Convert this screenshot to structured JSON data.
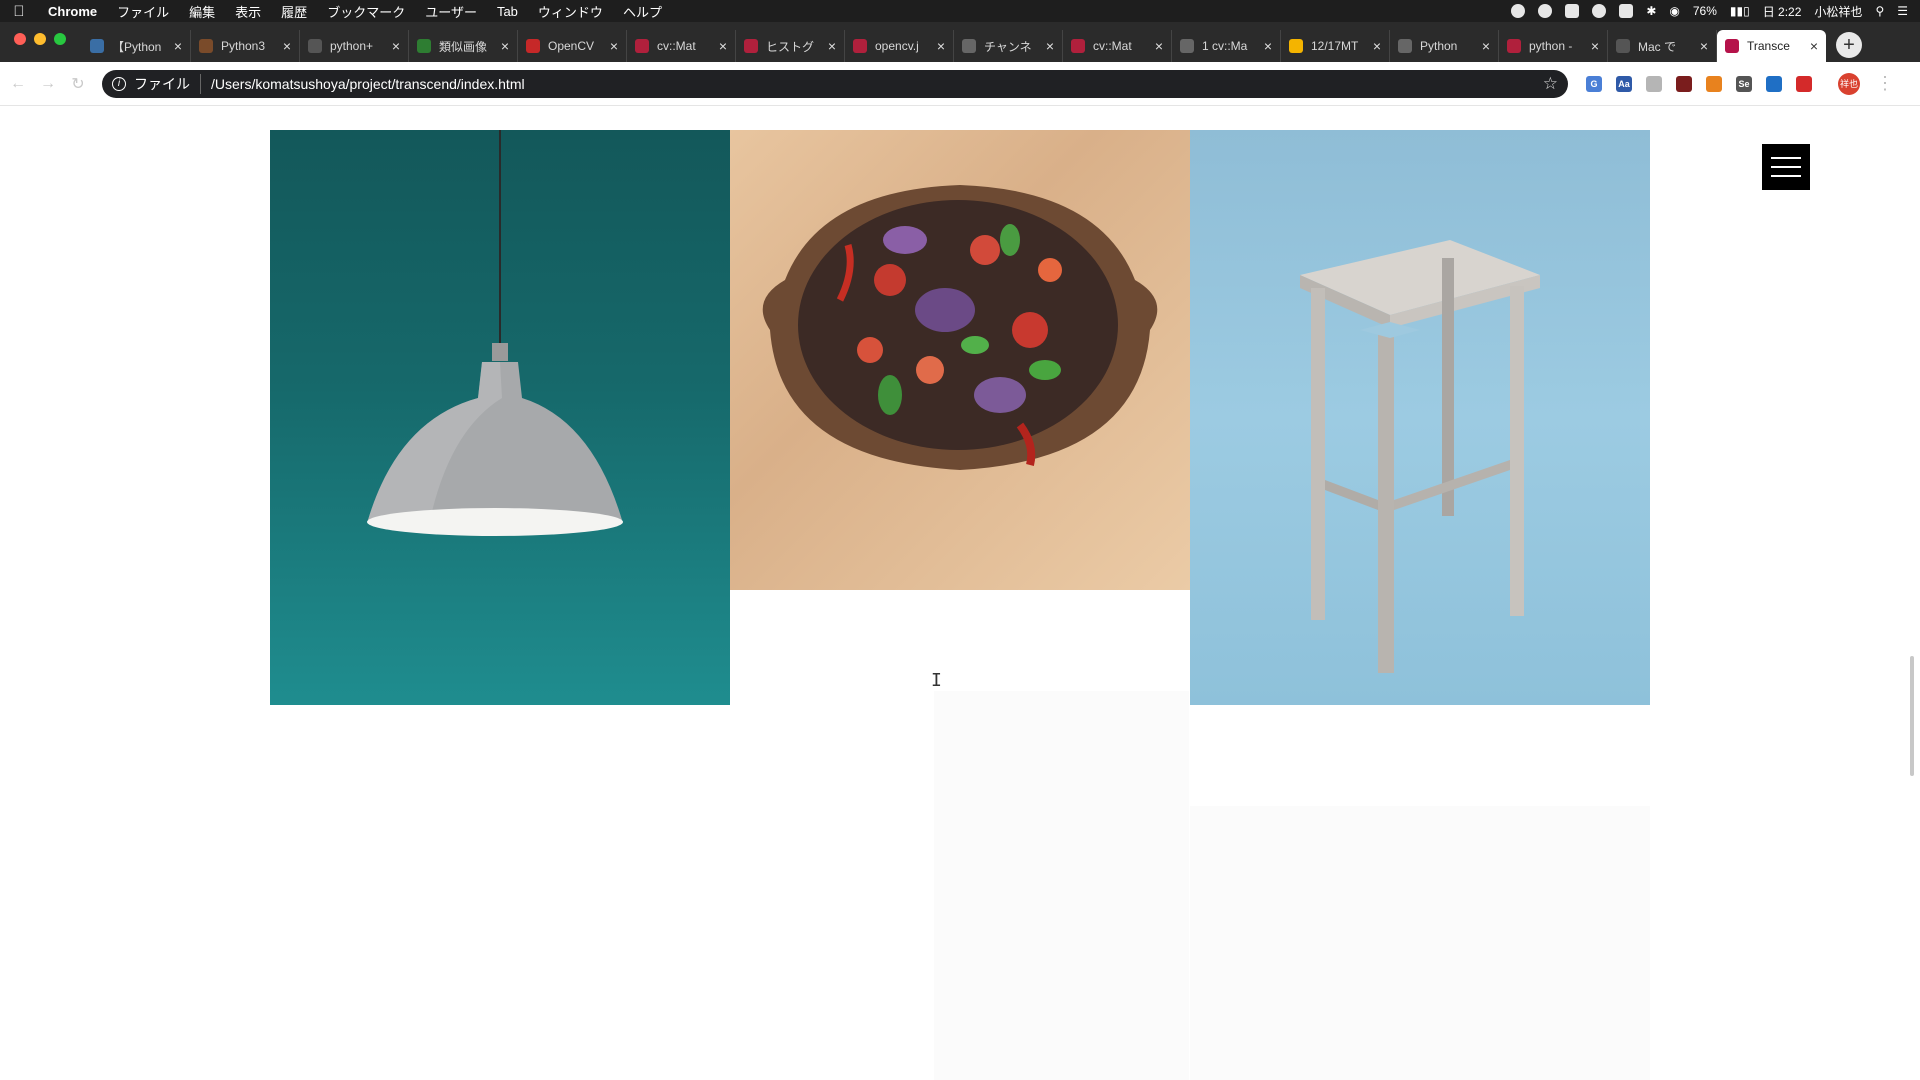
{
  "menubar": {
    "app_name": "Chrome",
    "menus": [
      "ファイル",
      "編集",
      "表示",
      "履歴",
      "ブックマーク",
      "ユーザー",
      "Tab",
      "ウィンドウ",
      "ヘルプ"
    ],
    "battery": "76%",
    "clock": "日 2:22",
    "user": "小松祥也"
  },
  "tabs": [
    {
      "title": "【Python",
      "color": "#3a6ea5",
      "icon": "cg-icon"
    },
    {
      "title": "Python3",
      "color": "#7a4b2a",
      "icon": "avatar-icon"
    },
    {
      "title": "python+",
      "color": "#555555",
      "icon": "info-icon"
    },
    {
      "title": "類似画像",
      "color": "#2e7d32",
      "icon": "leaf-icon"
    },
    {
      "title": "OpenCV",
      "color": "#c62828",
      "icon": "opencv-icon"
    },
    {
      "title": "cv::Mat",
      "color": "#b0203c",
      "icon": "qiita-icon"
    },
    {
      "title": "ヒストグ",
      "color": "#b0203c",
      "icon": "qiita-icon"
    },
    {
      "title": "opencv.j",
      "color": "#b0203c",
      "icon": "qiita-icon"
    },
    {
      "title": "チャンネ",
      "color": "#666666",
      "icon": "bird-icon"
    },
    {
      "title": "cv::Mat",
      "color": "#b0203c",
      "icon": "qiita-icon"
    },
    {
      "title": "1 cv::Ma",
      "color": "#666666",
      "icon": "globe-icon"
    },
    {
      "title": "12/17MT",
      "color": "#f4b400",
      "icon": "slides-icon"
    },
    {
      "title": "Python",
      "color": "#666666",
      "icon": "globe-icon"
    },
    {
      "title": "python -",
      "color": "#b0203c",
      "icon": "qiita-icon"
    },
    {
      "title": "Mac で",
      "color": "#555555",
      "icon": "apple-icon"
    },
    {
      "title": "Transce",
      "color": "#b5124a",
      "icon": "transcend-icon",
      "active": true
    }
  ],
  "toolbar": {
    "scheme_label": "ファイル",
    "url": "/Users/komatsushoya/project/transcend/index.html"
  },
  "photos": [
    {
      "name": "pendant-lamp",
      "subject": "lamp"
    },
    {
      "name": "salad-bowl",
      "subject": "bowl"
    },
    {
      "name": "wooden-stool",
      "subject": "stool"
    }
  ]
}
